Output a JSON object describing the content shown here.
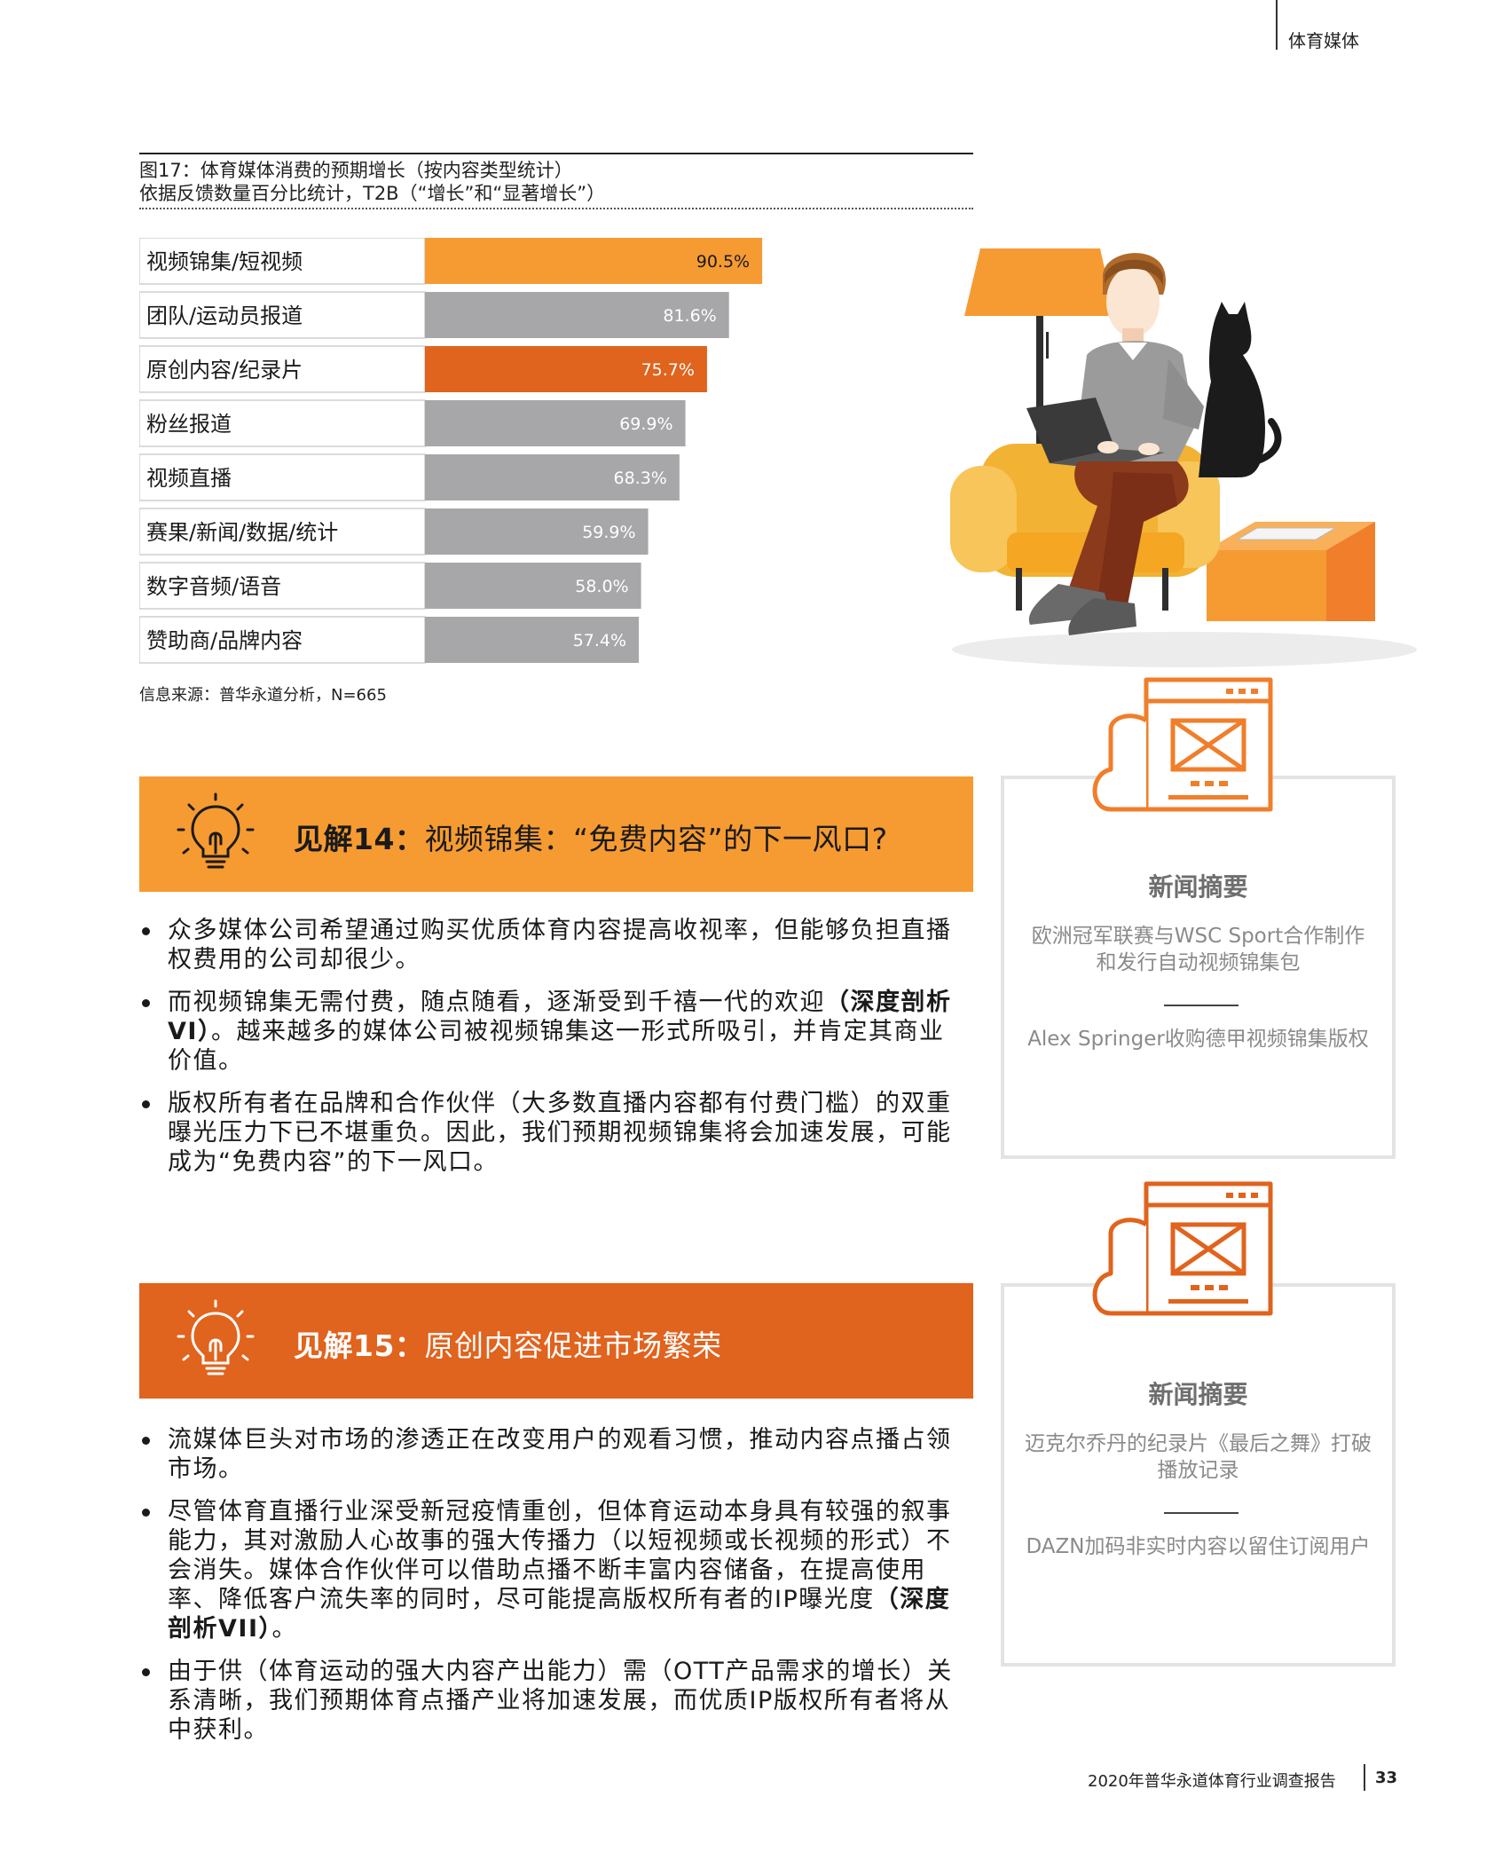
{
  "header": {
    "section": "体育媒体"
  },
  "figure": {
    "title": "图17：体育媒体消费的预期增长（按内容类型统计）",
    "subtitle": "依据反馈数量百分比统计，T2B（“增长”和“显著增长”）",
    "source": "信息来源：普华永道分析，N=665"
  },
  "chart_data": {
    "type": "bar",
    "orientation": "horizontal",
    "categories": [
      "视频锦集/短视频",
      "团队/运动员报道",
      "原创内容/纪录片",
      "粉丝报道",
      "视频直播",
      "赛果/新闻/数据/统计",
      "数字音频/语音",
      "赞助商/品牌内容"
    ],
    "values": [
      90.5,
      81.6,
      75.7,
      69.9,
      68.3,
      59.9,
      58.0,
      57.4
    ],
    "value_labels": [
      "90.5%",
      "81.6%",
      "75.7%",
      "69.9%",
      "68.3%",
      "59.9%",
      "58.0%",
      "57.4%"
    ],
    "xlim": [
      0,
      100
    ],
    "grid": false,
    "bar_colors": [
      "#f59b32",
      "#a7a7a9",
      "#e0631e",
      "#a7a7a9",
      "#a7a7a9",
      "#a7a7a9",
      "#a7a7a9",
      "#a7a7a9"
    ]
  },
  "insights": [
    {
      "number": "见解14：",
      "title": "视频锦集：“免费内容”的下一风口?",
      "color": "#f59b32",
      "bullets": [
        [
          "众多媒体公司希望通过购买优质体育内容提高收视率，但能够负担直播权费用的公司却很少。",
          "",
          ""
        ],
        [
          "而视频锦集无需付费，随点随看，逐渐受到千禧一代的欢迎",
          "（深度剖析VI）",
          "。越来越多的媒体公司被视频锦集这一形式所吸引，并肯定其商业价值。"
        ],
        [
          "版权所有者在品牌和合作伙伴（大多数直播内容都有付费门槛）的双重曝光压力下已不堪重负。因此，我们预期视频锦集将会加速发展，可能成为“免费内容”的下一风口。",
          "",
          ""
        ]
      ]
    },
    {
      "number": "见解15：",
      "title": "原创内容促进市场繁荣",
      "color": "#e0631e",
      "bullets": [
        [
          "流媒体巨头对市场的渗透正在改变用户的观看习惯，推动内容点播占领市场。",
          "",
          ""
        ],
        [
          "尽管体育直播行业深受新冠疫情重创，但体育运动本身具有较强的叙事能力，其对激励人心故事的强大传播力（以短视频或长视频的形式）不会消失。媒体合作伙伴可以借助点播不断丰富内容储备，在提高使用率、降低客户流失率的同时，尽可能提高版权所有者的IP曝光度",
          "（深度剖析VII）",
          "。"
        ],
        [
          "由于供（体育运动的强大内容产出能力）需（OTT产品需求的增长）关系清晰，我们预期体育点播产业将加速发展，而优质IP版权所有者将从中获利。",
          "",
          ""
        ]
      ]
    }
  ],
  "news": [
    {
      "heading": "新闻摘要",
      "item1": "欧洲冠军联赛与WSC Sport合作制作和发行自动视频锦集包",
      "item2": "Alex Springer收购德甲视频锦集版权"
    },
    {
      "heading": "新闻摘要",
      "item1": "迈克尔乔丹的纪录片《最后之舞》打破播放记录",
      "item2": "DAZN加码非实时内容以留住订阅用户"
    }
  ],
  "footer": {
    "report": "2020年普华永道体育行业调查报告",
    "page": "33"
  }
}
